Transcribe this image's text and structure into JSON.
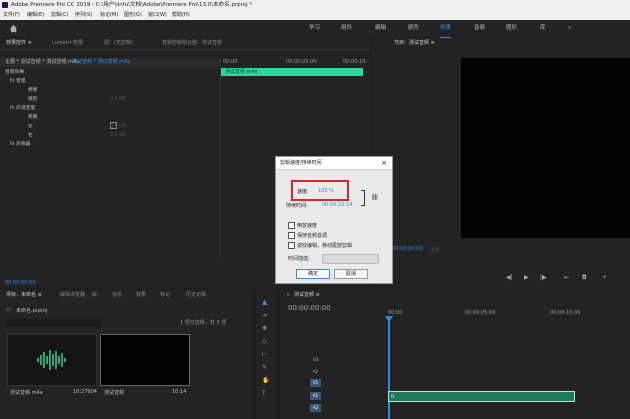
{
  "titlebar": {
    "title": "Adobe Premiere Pro CC 2019 - C:\\用户\\linfu\\文档\\Adobe\\Premiere Pro\\13.0\\未命名.prproj *"
  },
  "menubar": {
    "items": [
      "文件(F)",
      "编辑(E)",
      "剪辑(C)",
      "序列(S)",
      "标记(M)",
      "图形(G)",
      "窗口(W)",
      "帮助(H)"
    ]
  },
  "workspaces": {
    "tabs": [
      "学习",
      "组件",
      "编辑",
      "颜色",
      "效果",
      "音频",
      "图形",
      "库"
    ],
    "active": "效果"
  },
  "effect_controls": {
    "tabs": [
      "效果控件 ≡",
      "Lumetri 范围",
      "源：(无剪辑)",
      "音频剪辑混合器：测试音频"
    ],
    "source_label": "主要 * 测试音频 * 测试音频.m4a",
    "clip_label": "测试音频 * 测试音频.m4a",
    "section": "音频效果",
    "rows": [
      {
        "name": "fx  音量"
      },
      {
        "name": "旁路"
      },
      {
        "name": "级别",
        "value": "0.0 dB"
      },
      {
        "name": "fx  声道音量"
      },
      {
        "name": "旁路"
      },
      {
        "name": "左",
        "value": "0.0 dB"
      },
      {
        "name": "右",
        "value": "0.0 dB"
      },
      {
        "name": "fx  声像器"
      }
    ],
    "timecode_start": "00:00",
    "timecode_mid": "00:00:05:00",
    "timecode_end": "00:00:10",
    "clip_name": "测试音频.m4a",
    "footer_time": "00:00:00:00"
  },
  "program_monitor": {
    "tab": "节目：测试音频 ≡",
    "fit": "适合",
    "timecode": "00:00:00:00"
  },
  "speed_dialog": {
    "title": "剪辑速度/持续时间",
    "speed_label": "速度:",
    "speed_value": "100 %",
    "duration_label": "持续时间:",
    "duration_value": "00:00:10:14",
    "options": [
      "倒放速度",
      "保持音频音调",
      "波纹编辑，移动尾部剪辑"
    ],
    "interp_label": "时间插值:",
    "ok": "确定",
    "cancel": "取消"
  },
  "project_panel": {
    "tabs": [
      "项目：未命名 ≡",
      "媒体浏览器",
      "库",
      "信息",
      "效果",
      "标记",
      "历史记录"
    ],
    "name": "未命名.prproj",
    "selection": "1 项已选择，共 3 项",
    "items": [
      {
        "name": "测试音频.m4a",
        "duration": "10:27904"
      },
      {
        "name": "测试音频",
        "duration": "10:14"
      }
    ]
  },
  "timeline": {
    "tab": "测试音频 ≡",
    "timecode": "00:00:00:00",
    "ruler": [
      "00:00",
      "00:00:05:00",
      "00:00:10:00"
    ],
    "video_tracks": [
      "V3",
      "V2",
      "V1"
    ],
    "audio_tracks": [
      "A1",
      "A2"
    ],
    "audio_clip": "fx"
  },
  "colors": {
    "accent_blue": "#2d8ceb",
    "clip_green": "#2fd59f",
    "dialog_highlight": "#e0242b"
  }
}
